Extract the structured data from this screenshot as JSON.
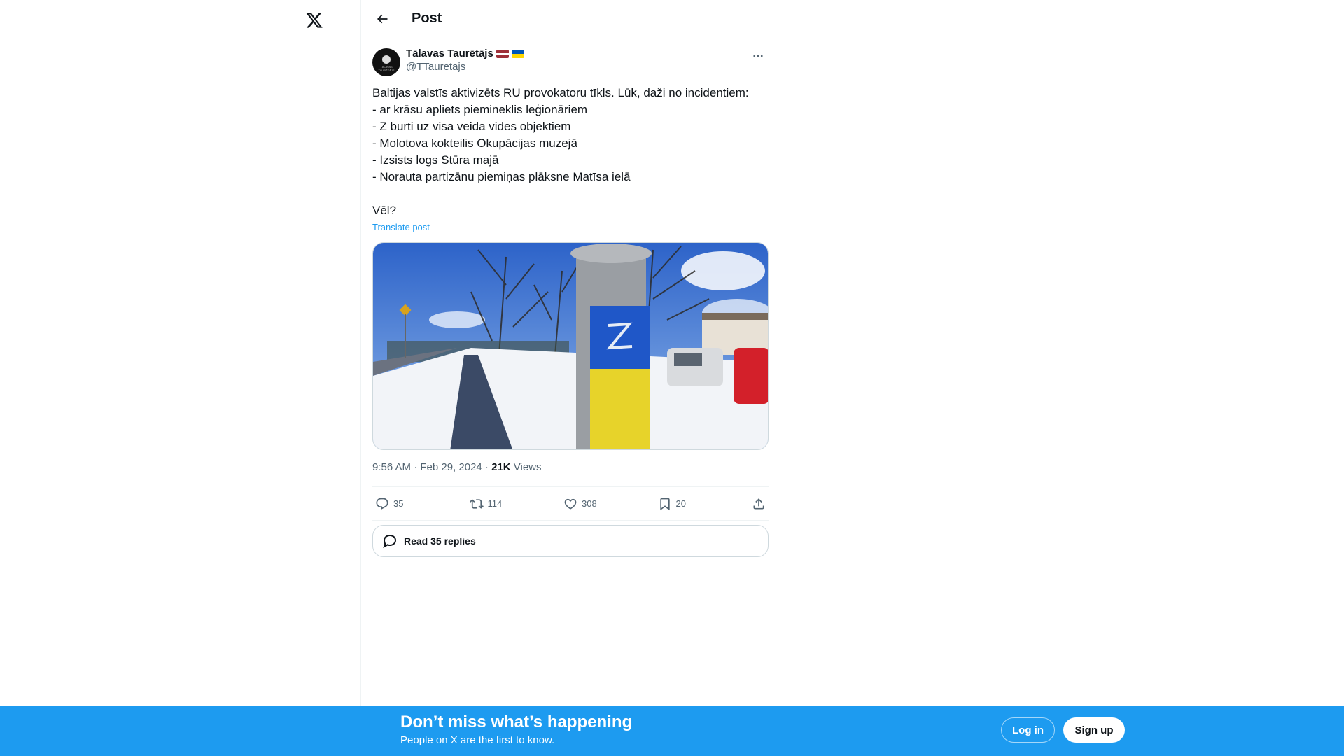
{
  "header": {
    "title": "Post"
  },
  "post": {
    "author_name": "Tālavas Taurētājs",
    "avatar_text": "TĀLAVAS TAURĒTĀJS",
    "handle": "@TTauretajs",
    "text": "Baltijas valstīs aktivizēts RU provokatoru tīkls. Lūk, daži no incidentiem:\n- ar krāsu apliets piemineklis leģionāriem\n- Z burti uz visa veida vides objektiem\n- Molotova kokteilis Okupācijas muzejā\n- Izsists logs Stūra majā\n- Norauta partizānu piemiņas plāksne Matīsa ielā\n\nVēl?",
    "translate_label": "Translate post",
    "time": "9:56 AM · Feb 29, 2024 · ",
    "views_count": "21K",
    "views_label": " Views"
  },
  "actions": {
    "replies": "35",
    "reposts": "114",
    "likes": "308",
    "bookmarks": "20"
  },
  "read_replies_label": "Read 35 replies",
  "banner": {
    "title": "Don’t miss what’s happening",
    "subtitle": "People on X are the first to know.",
    "login_label": "Log in",
    "signup_label": "Sign up"
  },
  "colors": {
    "accent": "#1d9bf0",
    "text_secondary": "#536471"
  }
}
